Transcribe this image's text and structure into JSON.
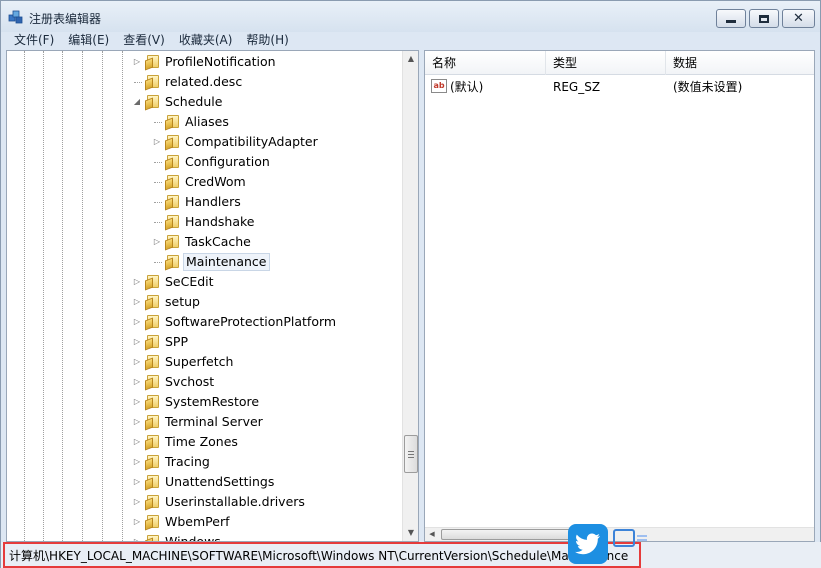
{
  "window": {
    "title": "注册表编辑器"
  },
  "menu": [
    "文件(F)",
    "编辑(E)",
    "查看(V)",
    "收藏夹(A)",
    "帮助(H)"
  ],
  "tree": [
    {
      "label": "ProfileNotification",
      "level": 0,
      "expander": "collapsed"
    },
    {
      "label": "related.desc",
      "level": 0,
      "expander": "none"
    },
    {
      "label": "Schedule",
      "level": 0,
      "expander": "expanded"
    },
    {
      "label": "Aliases",
      "level": 1,
      "expander": "none"
    },
    {
      "label": "CompatibilityAdapter",
      "level": 1,
      "expander": "collapsed"
    },
    {
      "label": "Configuration",
      "level": 1,
      "expander": "none"
    },
    {
      "label": "CredWom",
      "level": 1,
      "expander": "none"
    },
    {
      "label": "Handlers",
      "level": 1,
      "expander": "none"
    },
    {
      "label": "Handshake",
      "level": 1,
      "expander": "none"
    },
    {
      "label": "TaskCache",
      "level": 1,
      "expander": "collapsed"
    },
    {
      "label": "Maintenance",
      "level": 1,
      "expander": "none",
      "selected": true
    },
    {
      "label": "SeCEdit",
      "level": 0,
      "expander": "collapsed"
    },
    {
      "label": "setup",
      "level": 0,
      "expander": "collapsed"
    },
    {
      "label": "SoftwareProtectionPlatform",
      "level": 0,
      "expander": "collapsed"
    },
    {
      "label": "SPP",
      "level": 0,
      "expander": "collapsed"
    },
    {
      "label": "Superfetch",
      "level": 0,
      "expander": "collapsed"
    },
    {
      "label": "Svchost",
      "level": 0,
      "expander": "collapsed"
    },
    {
      "label": "SystemRestore",
      "level": 0,
      "expander": "collapsed"
    },
    {
      "label": "Terminal Server",
      "level": 0,
      "expander": "collapsed"
    },
    {
      "label": "Time Zones",
      "level": 0,
      "expander": "collapsed"
    },
    {
      "label": "Tracing",
      "level": 0,
      "expander": "collapsed"
    },
    {
      "label": "UnattendSettings",
      "level": 0,
      "expander": "collapsed"
    },
    {
      "label": "Userinstallable.drivers",
      "level": 0,
      "expander": "collapsed"
    },
    {
      "label": "WbemPerf",
      "level": 0,
      "expander": "collapsed"
    },
    {
      "label": "Windows",
      "level": 0,
      "expander": "collapsed"
    }
  ],
  "list": {
    "columns": [
      "名称",
      "类型",
      "数据"
    ],
    "rows": [
      {
        "name": "(默认)",
        "type": "REG_SZ",
        "data": "(数值未设置)",
        "icon": "ab"
      }
    ]
  },
  "status": {
    "path": "计算机\\HKEY_LOCAL_MACHINE\\SOFTWARE\\Microsoft\\Windows NT\\CurrentVersion\\Schedule\\Maintenance"
  },
  "colors": {
    "highlight": "#e53b3b",
    "watermark": "#1d8fe2"
  }
}
